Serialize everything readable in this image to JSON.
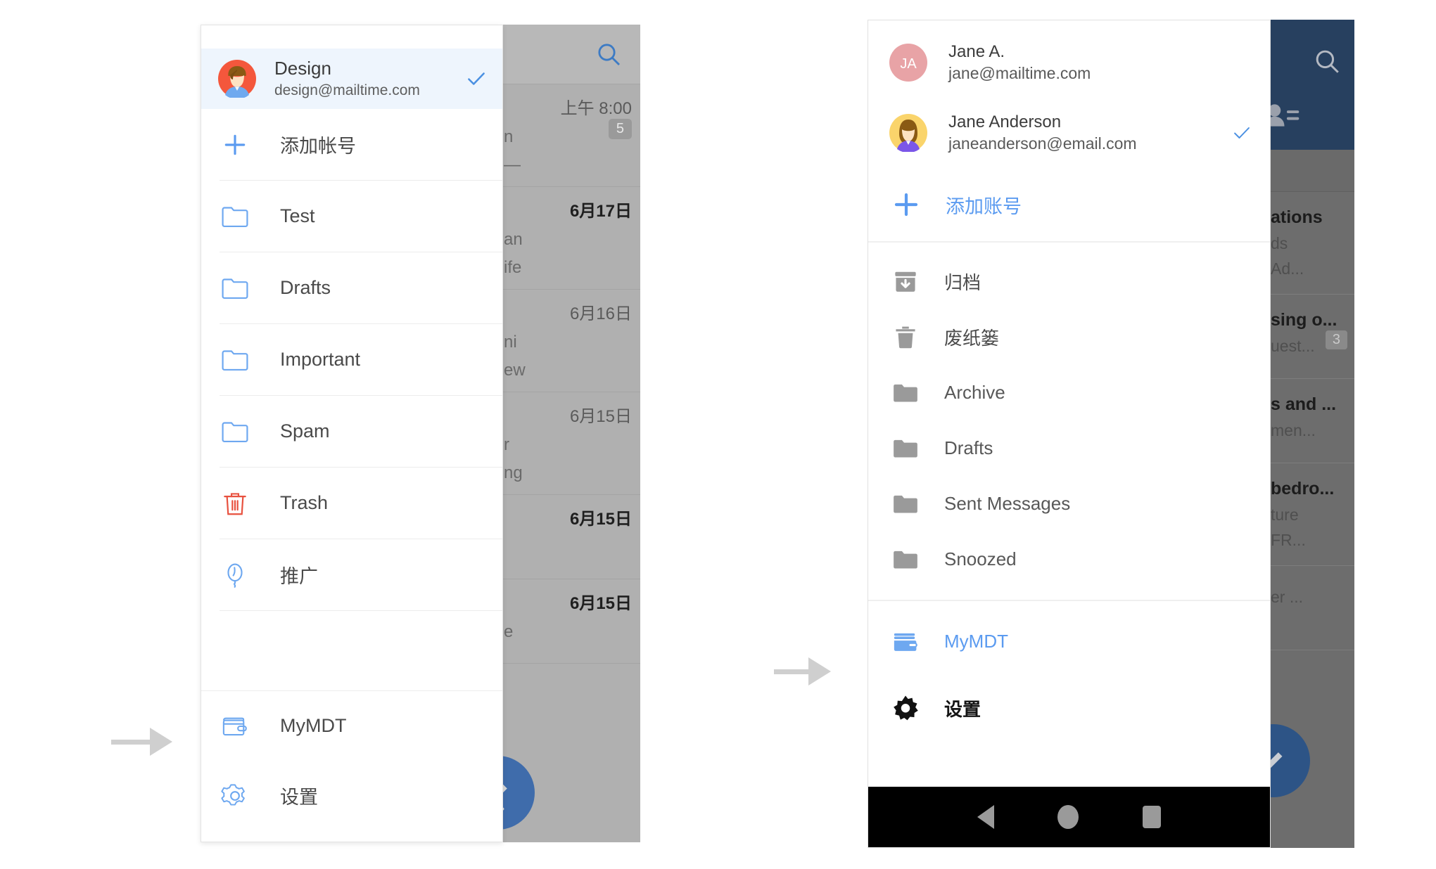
{
  "left": {
    "drawer": {
      "account": {
        "name": "Design",
        "email": "design@mailtime.com",
        "avatar_icon": "avatar-person-icon",
        "selected_icon": "check-icon",
        "selected": true
      },
      "add_account": {
        "label": "添加帐号",
        "icon": "plus-icon"
      },
      "folders": [
        {
          "label": "Test",
          "icon": "folder-outline-icon"
        },
        {
          "label": "Drafts",
          "icon": "folder-outline-icon"
        },
        {
          "label": "Important",
          "icon": "folder-outline-icon"
        },
        {
          "label": "Spam",
          "icon": "folder-outline-icon"
        },
        {
          "label": "Trash",
          "icon": "trash-outline-icon"
        },
        {
          "label": "推广",
          "icon": "balloon-outline-icon"
        }
      ],
      "bottom": [
        {
          "label": "MyMDT",
          "icon": "wallet-outline-icon"
        },
        {
          "label": "设置",
          "icon": "gear-outline-icon"
        }
      ]
    },
    "background": {
      "search_icon": "search-icon",
      "compose_icon": "pencil-icon",
      "rows": [
        {
          "date": "上午 8:00",
          "badge": "5",
          "line1": "n",
          "line2": "—",
          "bold": false
        },
        {
          "date": "6月17日",
          "badge": "",
          "line1": "an",
          "line2": "ife",
          "bold": true
        },
        {
          "date": "6月16日",
          "badge": "",
          "line1": "ni",
          "line2": "ew",
          "bold": false
        },
        {
          "date": "6月15日",
          "badge": "",
          "line1": "r",
          "line2": "ng",
          "bold": false
        },
        {
          "date": "6月15日",
          "badge": "",
          "line1": "",
          "line2": "",
          "bold": true
        },
        {
          "date": "6月15日",
          "badge": "",
          "line1": "",
          "line2": "e",
          "bold": true
        }
      ]
    }
  },
  "right": {
    "drawer": {
      "accounts": [
        {
          "name": "Jane A.",
          "email": "jane@mailtime.com",
          "avatar_icon": "avatar-initials-icon",
          "initials": "JA",
          "avatar_color": "#e8a3a6",
          "selected": false
        },
        {
          "name": "Jane Anderson",
          "email": "janeanderson@email.com",
          "avatar_icon": "avatar-person-icon",
          "avatar_color": "#fad46b",
          "selected": true,
          "selected_icon": "check-icon"
        }
      ],
      "add_account": {
        "label": "添加账号",
        "icon": "plus-icon"
      },
      "folders": [
        {
          "label": "归档",
          "icon": "archive-icon",
          "cjk": true
        },
        {
          "label": "废纸篓",
          "icon": "trash-filled-icon",
          "cjk": true
        },
        {
          "label": "Archive",
          "icon": "folder-filled-icon",
          "cjk": false
        },
        {
          "label": "Drafts",
          "icon": "folder-filled-icon",
          "cjk": false
        },
        {
          "label": "Sent Messages",
          "icon": "folder-filled-icon",
          "cjk": false
        },
        {
          "label": "Snoozed",
          "icon": "folder-filled-icon",
          "cjk": false
        }
      ],
      "bottom": [
        {
          "label": "MyMDT",
          "icon": "wallet-filled-icon",
          "style": "accent"
        },
        {
          "label": "设置",
          "icon": "gear-filled-icon",
          "style": "settings"
        }
      ]
    },
    "background": {
      "search_icon": "search-icon",
      "contacts_icon": "contacts-icon",
      "compose_icon": "pencil-icon",
      "rows": [
        {
          "title": "ations",
          "sub1": "ds",
          "sub2": "Ad...",
          "badge": ""
        },
        {
          "title": "sing o...",
          "sub1": "",
          "sub2": "uest...",
          "badge": "3"
        },
        {
          "title": "s and ...",
          "sub1": "",
          "sub2": "men...",
          "badge": ""
        },
        {
          "title": "bedro...",
          "sub1": "ture",
          "sub2": "FR...",
          "badge": ""
        },
        {
          "title": "",
          "sub1": "",
          "sub2": "er ...",
          "badge": ""
        }
      ]
    },
    "navbar": {
      "back_icon": "nav-back-icon",
      "home_icon": "nav-home-icon",
      "recents_icon": "nav-recents-icon"
    }
  },
  "annotations": {
    "arrow_left": "arrow-right-icon",
    "arrow_middle": "arrow-right-icon"
  },
  "colors": {
    "accent_blue": "#5b9bf0",
    "selected_row_bg": "#eef5fd",
    "trash_red": "#e8513f",
    "fab_blue": "#3f6cab",
    "navy_header": "#27405f"
  }
}
